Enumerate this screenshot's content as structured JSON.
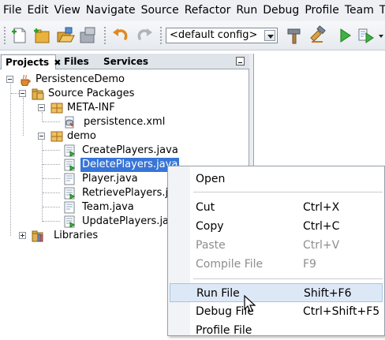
{
  "menu_bar": {
    "items": [
      "File",
      "Edit",
      "View",
      "Navigate",
      "Source",
      "Refactor",
      "Run",
      "Debug",
      "Profile",
      "Team",
      "T"
    ]
  },
  "toolbar": {
    "config_value": "<default config>",
    "buttons": [
      "new-file-icon",
      "new-project-icon",
      "open-project-icon",
      "close-project-icon",
      "undo-icon",
      "redo-icon",
      "build-hammer-icon",
      "clean-build-icon",
      "run-icon",
      "debug-icon"
    ]
  },
  "projects_panel": {
    "tabs": [
      "Projects",
      "Files",
      "Services"
    ],
    "close_glyph": "✖"
  },
  "tree": {
    "root": "PersistenceDemo",
    "source_packages": "Source Packages",
    "meta_inf": "META-INF",
    "persistence_xml": "persistence.xml",
    "demo": "demo",
    "files": [
      "CreatePlayers.java",
      "DeletePlayers.java",
      "Player.java",
      "RetrievePlayers.java",
      "Team.java",
      "UpdatePlayers.java"
    ],
    "selected_file": "DeletePlayers.java",
    "libraries": "Libraries"
  },
  "context_menu": {
    "items": [
      {
        "label": "Open",
        "shortcut": "",
        "enabled": true
      },
      {
        "label": "Cut",
        "shortcut": "Ctrl+X",
        "enabled": true
      },
      {
        "label": "Copy",
        "shortcut": "Ctrl+C",
        "enabled": true
      },
      {
        "label": "Paste",
        "shortcut": "Ctrl+V",
        "enabled": false
      },
      {
        "label": "Compile File",
        "shortcut": "F9",
        "enabled": false
      },
      {
        "label": "Run File",
        "shortcut": "Shift+F6",
        "enabled": true,
        "hovered": true
      },
      {
        "label": "Debug File",
        "shortcut": "Ctrl+Shift+F5",
        "enabled": true
      },
      {
        "label": "Profile File",
        "shortcut": "",
        "enabled": true
      }
    ]
  },
  "colors": {
    "selection": "#3875d7",
    "menu_hover": "#dde8f7",
    "disabled_text": "#8d8d8d"
  }
}
